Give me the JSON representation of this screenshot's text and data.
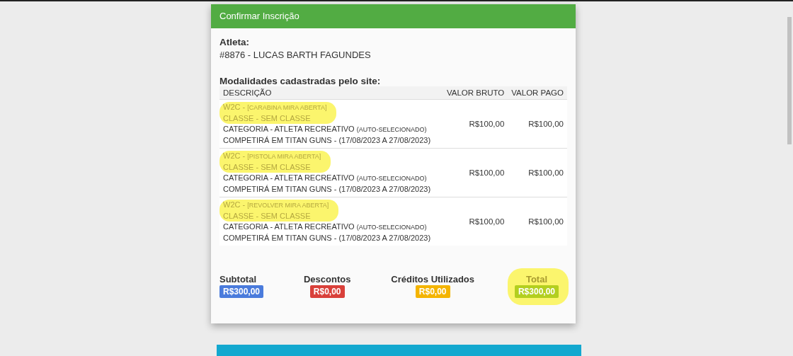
{
  "panel": {
    "title": "Confirmar Inscrição"
  },
  "athlete": {
    "label": "Atleta:",
    "value": "#8876 - LUCAS BARTH FAGUNDES"
  },
  "modalities": {
    "title": "Modalidades cadastradas pelo site:",
    "columns": [
      "DESCRIÇÃO",
      "VALOR BRUTO",
      "VALOR PAGO"
    ],
    "rows": [
      {
        "event": "W2C - ",
        "modality": "[CARABINA MIRA ABERTA]",
        "class": "CLASSE - SEM CLASSE",
        "category": "CATEGORIA - ATLETA RECREATIVO ",
        "category_note": "(AUTO-SELECIONADO)",
        "venue": "COMPETIRÁ EM TITAN GUNS - (17/08/2023 A 27/08/2023)",
        "gross": "R$100,00",
        "paid": "R$100,00",
        "highlighted": true
      },
      {
        "event": "W2C - ",
        "modality": "[PISTOLA MIRA ABERTA]",
        "class": "CLASSE - SEM CLASSE",
        "category": "CATEGORIA - ATLETA RECREATIVO ",
        "category_note": "(AUTO-SELECIONADO)",
        "venue": "COMPETIRÁ EM TITAN GUNS - (17/08/2023 A 27/08/2023)",
        "gross": "R$100,00",
        "paid": "R$100,00",
        "highlighted": true
      },
      {
        "event": "W2C - ",
        "modality": "[REVOLVER MIRA ABERTA]",
        "class": "CLASSE - SEM CLASSE",
        "category": "CATEGORIA - ATLETA RECREATIVO ",
        "category_note": "(AUTO-SELECIONADO)",
        "venue": "COMPETIRÁ EM TITAN GUNS - (17/08/2023 A 27/08/2023)",
        "gross": "R$100,00",
        "paid": "R$100,00",
        "highlighted": true
      }
    ]
  },
  "totals": [
    {
      "label": "Subtotal",
      "value": "R$300,00",
      "color": "#4a7bdc",
      "highlighted": false
    },
    {
      "label": "Descontos",
      "value": "R$0,00",
      "color": "#d9403a",
      "highlighted": false
    },
    {
      "label": "Créditos Utilizados",
      "value": "R$0,00",
      "color": "#f4b400",
      "highlighted": false
    },
    {
      "label": "Total",
      "value": "R$300,00",
      "color": "#b3cf1f",
      "highlighted": true
    }
  ]
}
